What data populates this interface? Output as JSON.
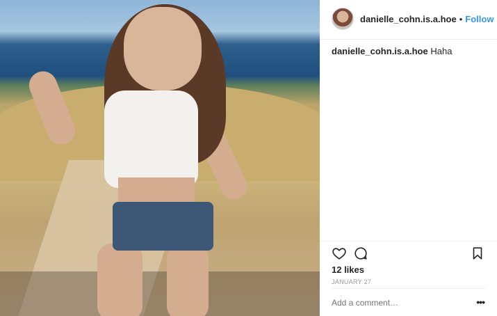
{
  "post": {
    "image_alt": "photo"
  },
  "header": {
    "username": "danielle_cohn.is.a.hoe",
    "separator": "•",
    "follow_label": "Follow"
  },
  "caption": {
    "username": "danielle_cohn.is.a.hoe",
    "text": "Haha"
  },
  "actions": {
    "like_icon": "heart-icon",
    "comment_icon": "comment-icon",
    "save_icon": "bookmark-icon"
  },
  "likes": "12 likes",
  "date": "JANUARY 27",
  "comment": {
    "placeholder": "Add a comment…",
    "more": "•••"
  },
  "colors": {
    "link": "#3897f0",
    "text": "#262626",
    "muted": "#999999",
    "divider": "#efefef"
  }
}
